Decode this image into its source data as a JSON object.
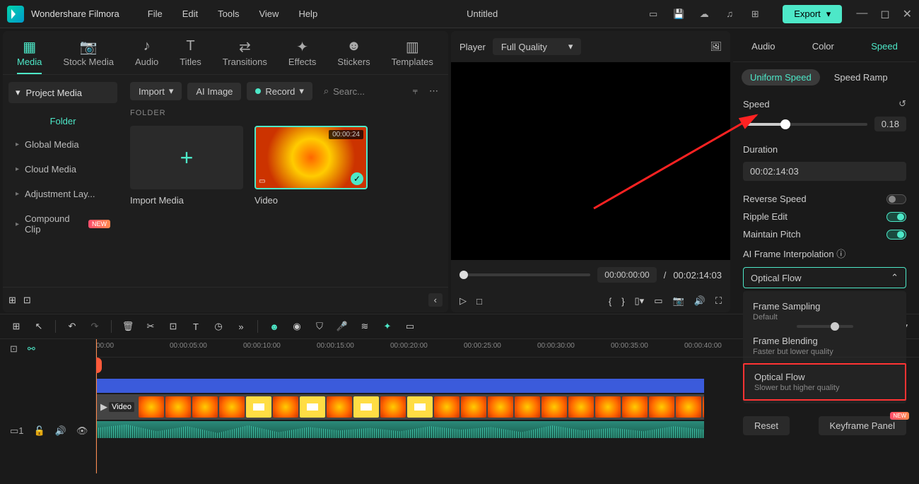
{
  "app_name": "Wondershare Filmora",
  "menubar": [
    "File",
    "Edit",
    "Tools",
    "View",
    "Help"
  ],
  "project_title": "Untitled",
  "export_label": "Export",
  "media_tabs": [
    {
      "label": "Media",
      "active": true
    },
    {
      "label": "Stock Media"
    },
    {
      "label": "Audio"
    },
    {
      "label": "Titles"
    },
    {
      "label": "Transitions"
    },
    {
      "label": "Effects"
    },
    {
      "label": "Stickers"
    },
    {
      "label": "Templates"
    }
  ],
  "sidebar": {
    "project_media": "Project Media",
    "folder_label": "Folder",
    "items": [
      "Global Media",
      "Cloud Media",
      "Adjustment Lay...",
      "Compound Clip"
    ],
    "new_badge": "NEW"
  },
  "toolbar": {
    "import": "Import",
    "ai_image": "AI Image",
    "record": "Record",
    "search_placeholder": "Searc..."
  },
  "folder_section": "FOLDER",
  "media_cards": {
    "import": "Import Media",
    "video": "Video",
    "video_duration": "00:00:24"
  },
  "player": {
    "label": "Player",
    "quality": "Full Quality",
    "time_current": "00:00:00:00",
    "time_sep": "/",
    "time_total": "00:02:14:03"
  },
  "right": {
    "tabs": [
      "Audio",
      "Color",
      "Speed"
    ],
    "sub_tabs": [
      "Uniform Speed",
      "Speed Ramp"
    ],
    "speed_label": "Speed",
    "speed_value": "0.18",
    "duration_label": "Duration",
    "duration_value": "00:02:14:03",
    "reverse_label": "Reverse Speed",
    "ripple_label": "Ripple Edit",
    "pitch_label": "Maintain Pitch",
    "interp_label": "AI Frame Interpolation",
    "interp_selected": "Optical Flow",
    "dropdown": [
      {
        "title": "Frame Sampling",
        "sub": "Default"
      },
      {
        "title": "Frame Blending",
        "sub": "Faster but lower quality"
      },
      {
        "title": "Optical Flow",
        "sub": "Slower but higher quality"
      }
    ],
    "reset": "Reset",
    "keyframe": "Keyframe Panel",
    "keyframe_badge": "NEW"
  },
  "timeline": {
    "ruler": [
      "00:00",
      "00:00:05:00",
      "00:00:10:00",
      "00:00:15:00",
      "00:00:20:00",
      "00:00:25:00",
      "00:00:30:00",
      "00:00:35:00",
      "00:00:40:00"
    ],
    "video_label": "Video"
  }
}
